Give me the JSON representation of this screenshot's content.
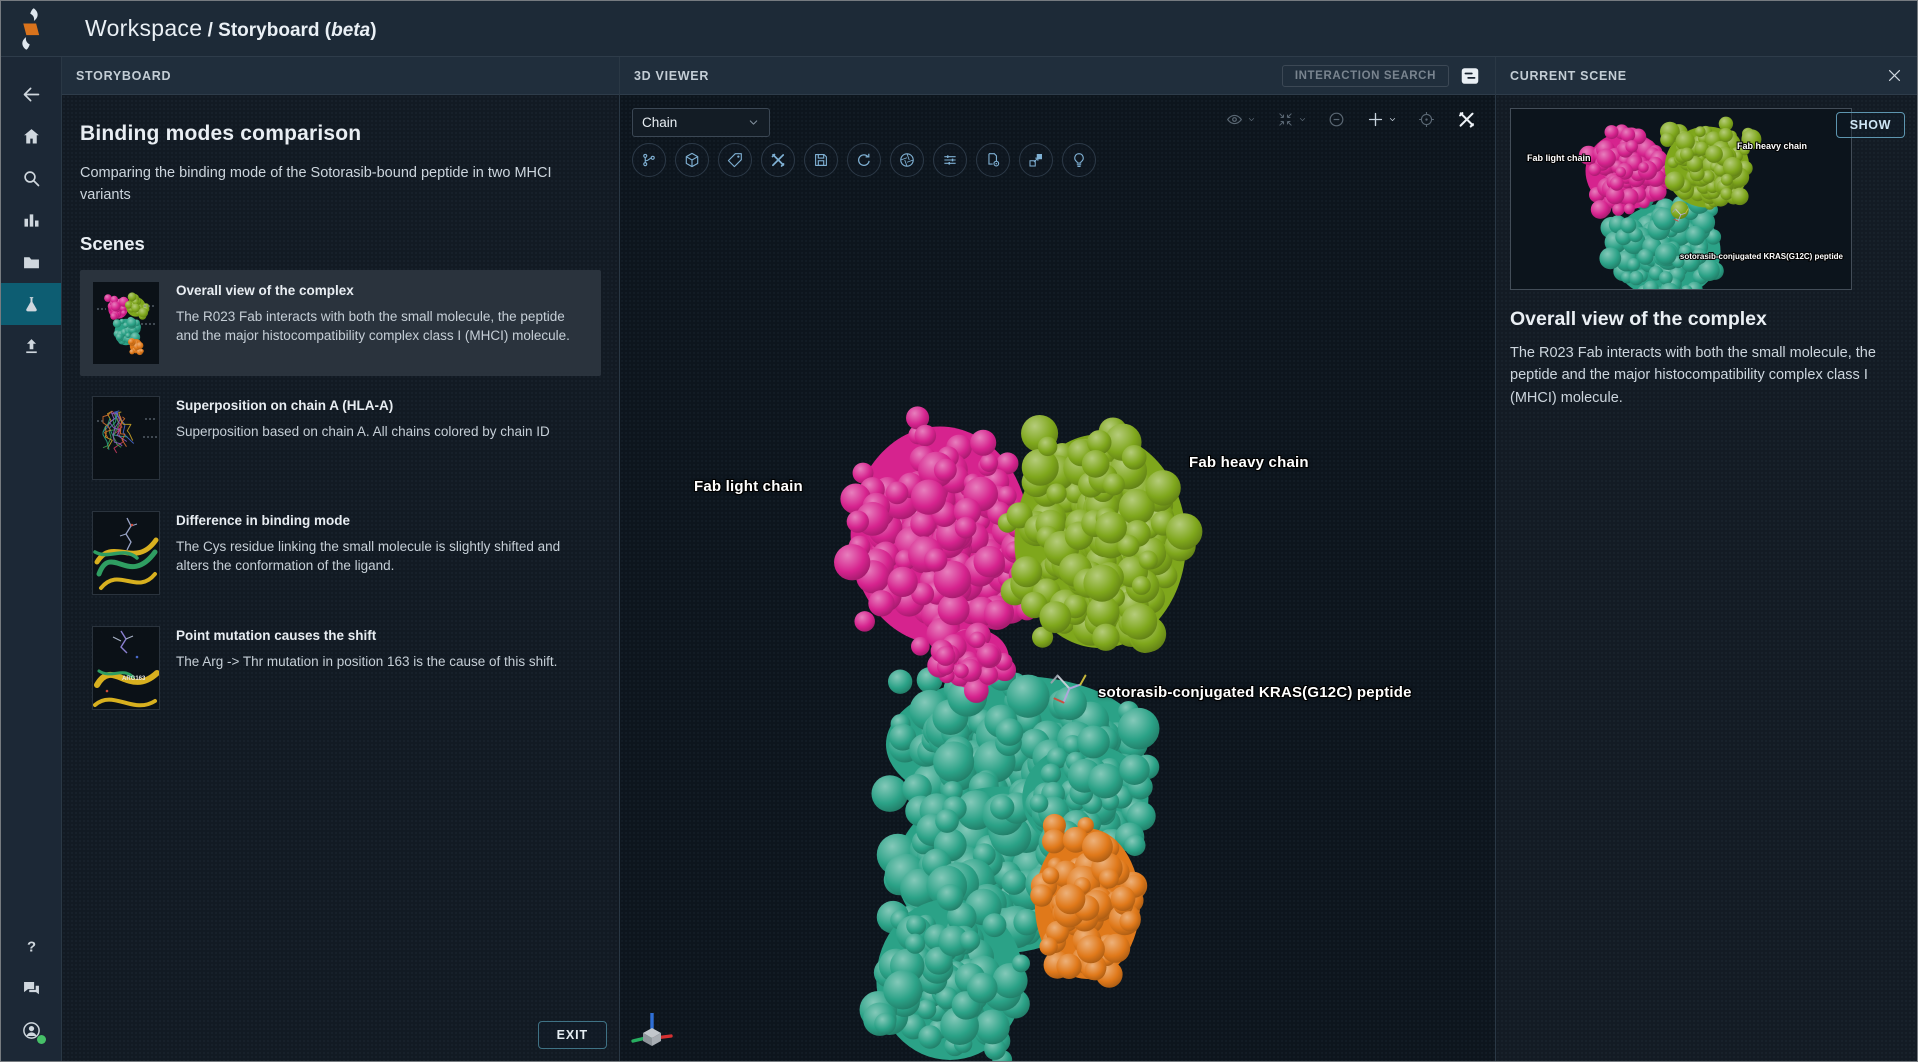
{
  "topbar": {
    "parts": [
      "Workspace",
      " / Storyboard (",
      "beta",
      ")"
    ]
  },
  "sidebar": {
    "items": [
      "back",
      "home",
      "search",
      "analytics",
      "files",
      "lab",
      "upload",
      "help",
      "feedback",
      "account"
    ],
    "active_item": "lab",
    "account_status": "online"
  },
  "storyboard": {
    "header": "STORYBOARD",
    "title": "Binding modes comparison",
    "description": "Comparing the binding mode of the Sotorasib-bound peptide in two MHCI variants",
    "scenes_heading": "Scenes",
    "scenes": [
      {
        "title": "Overall view of the complex",
        "description": "The R023 Fab interacts with both the small molecule, the peptide and the major histocompatibility complex class I (MHCI) molecule.",
        "selected": true,
        "thumb": "surface"
      },
      {
        "title": "Superposition on chain A (HLA-A)",
        "description": "Superposition based on chain A. All chains colored by chain ID",
        "selected": false,
        "thumb": "lines"
      },
      {
        "title": "Difference in binding mode",
        "description": "The Cys residue linking the small molecule is slightly shifted and alters the conformation of the ligand.",
        "selected": false,
        "thumb": "cartoon"
      },
      {
        "title": "Point mutation causes the shift",
        "description": "The Arg -> Thr mutation in position 163 is the cause of this shift.",
        "selected": false,
        "thumb": "mutation",
        "thumb_label": "ARG163"
      }
    ],
    "exit_label": "EXIT"
  },
  "viewer": {
    "header": "3D VIEWER",
    "interaction_search_label": "INTERACTION SEARCH",
    "chain_select_value": "Chain",
    "toolbar_icons": [
      "measurements",
      "structure-cube",
      "label-tag",
      "tools",
      "save",
      "reset-view",
      "screenshot",
      "settings-sliders",
      "state-file-gear",
      "expand",
      "lighting-bulb"
    ],
    "viewport_icons": [
      "visibility-eye",
      "expand-arrows",
      "zoom-out",
      "add-plus",
      "center-target",
      "tools-active"
    ],
    "labels": [
      {
        "text": "Fab light chain"
      },
      {
        "text": "Fab heavy chain"
      },
      {
        "text": "sotorasib-conjugated KRAS(G12C) peptide"
      }
    ]
  },
  "current_scene": {
    "header": "CURRENT SCENE",
    "show_label": "SHOW",
    "title": "Overall view of the complex",
    "description": "The R023 Fab interacts with both the small molecule, the peptide and the major histocompatibility complex class I (MHCI) molecule.",
    "thumb_labels": [
      "Fab light chain",
      "Fab heavy chain",
      "sotorasib-conjugated KRAS(G12C) peptide"
    ]
  },
  "colors": {
    "accent_teal": "#0d5d72",
    "toolbar_icon_blue": "#7fb0d3",
    "fab_light_chain": "#d6238e",
    "fab_heavy_chain": "#7fa71c",
    "mhc": "#2ba287",
    "b2m": "#e0791a",
    "status_online": "#46c068"
  }
}
